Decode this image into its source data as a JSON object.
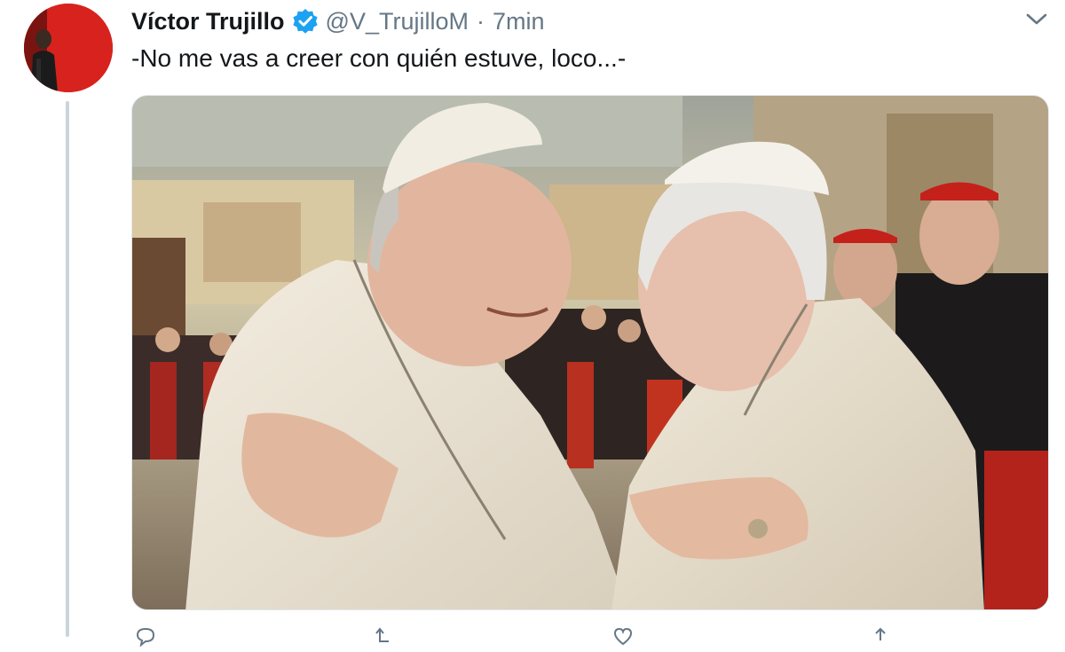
{
  "tweet": {
    "display_name": "Víctor Trujillo",
    "handle": "@V_TrujilloM",
    "separator": "·",
    "time": "7min",
    "text": "-No me vas a creer con quién estuve, loco...-",
    "verified": true
  },
  "icons": {
    "avatar": "profile-photo",
    "verified": "verified-badge-icon",
    "menu": "chevron-down-icon",
    "reply": "reply-icon",
    "retweet": "retweet-icon",
    "like": "heart-icon",
    "share": "share-icon"
  },
  "colors": {
    "verified_blue": "#1da1f2",
    "secondary_text": "#657786",
    "primary_text": "#14171a",
    "avatar_background": "#d9231f"
  }
}
